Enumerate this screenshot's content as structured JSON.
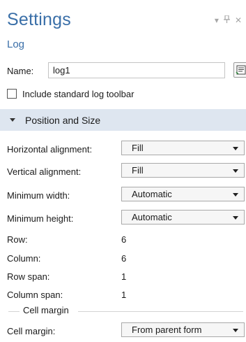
{
  "header": {
    "title": "Settings",
    "subtitle": "Log",
    "window_controls": [
      "chevron-down-icon",
      "pin-icon",
      "close-icon"
    ]
  },
  "name_field": {
    "label": "Name:",
    "value": "log1"
  },
  "include_toolbar": {
    "label": "Include standard log toolbar",
    "checked": false
  },
  "section": {
    "title": "Position and Size",
    "expanded": true
  },
  "properties": {
    "horizontal_alignment": {
      "label": "Horizontal alignment:",
      "value": "Fill"
    },
    "vertical_alignment": {
      "label": "Vertical alignment:",
      "value": "Fill"
    },
    "minimum_width": {
      "label": "Minimum width:",
      "value": "Automatic"
    },
    "minimum_height": {
      "label": "Minimum height:",
      "value": "Automatic"
    },
    "row": {
      "label": "Row:",
      "value": "6"
    },
    "column": {
      "label": "Column:",
      "value": "6"
    },
    "row_span": {
      "label": "Row span:",
      "value": "1"
    },
    "column_span": {
      "label": "Column span:",
      "value": "1"
    }
  },
  "cell_margin_group": {
    "title": "Cell margin",
    "label": "Cell margin:",
    "value": "From parent form"
  },
  "colors": {
    "title_blue": "#3a6fa8",
    "section_bg": "#dee6f0"
  }
}
